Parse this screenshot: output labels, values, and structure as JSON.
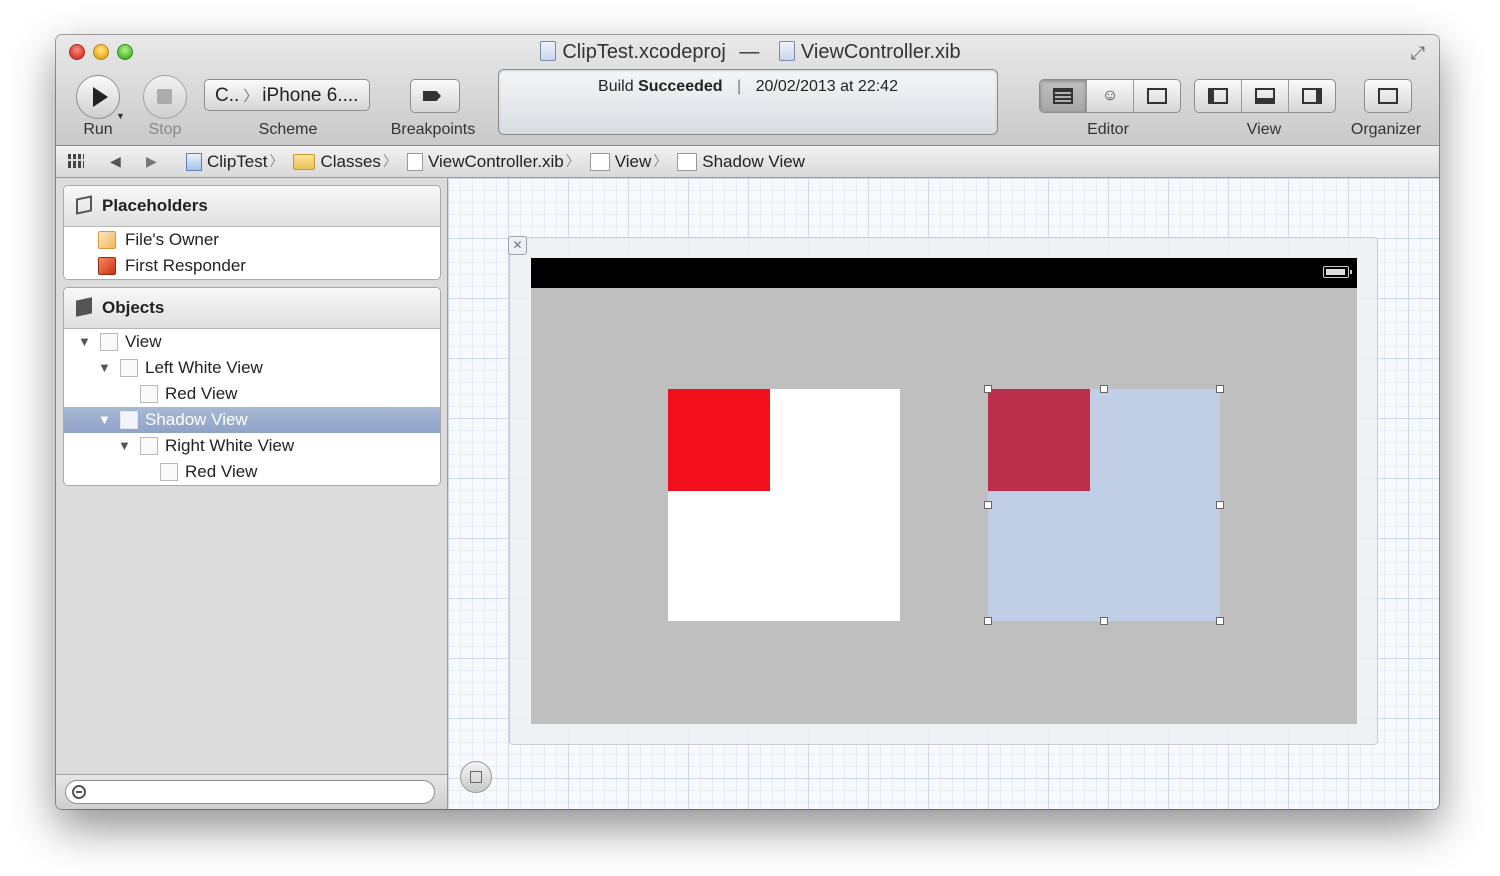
{
  "window": {
    "project_name": "ClipTest.xcodeproj",
    "title_separator": "—",
    "file_name": "ViewController.xib"
  },
  "toolbar": {
    "run_label": "Run",
    "stop_label": "Stop",
    "scheme_target": "C..",
    "scheme_device": "iPhone 6....",
    "scheme_label": "Scheme",
    "breakpoints_label": "Breakpoints",
    "editor_label": "Editor",
    "view_label": "View",
    "organizer_label": "Organizer"
  },
  "activity": {
    "prefix": "Build",
    "status": "Succeeded",
    "timestamp": "20/02/2013 at 22:42"
  },
  "jumpbar": {
    "crumbs": [
      "ClipTest",
      "Classes",
      "ViewController.xib",
      "View",
      "Shadow View"
    ]
  },
  "outline": {
    "placeholders_header": "Placeholders",
    "placeholders": [
      "File's Owner",
      "First Responder"
    ],
    "objects_header": "Objects",
    "objects": [
      "View",
      "Left White View",
      "Red View",
      "Shadow View",
      "Right White View",
      "Red View"
    ],
    "selected": "Shadow View"
  },
  "canvas": {
    "background_color": "#bfbfbf",
    "left_red_color": "#f40f1c",
    "right_red_color": "#bc2f4c",
    "selection_tint": "#c0cfe6"
  }
}
